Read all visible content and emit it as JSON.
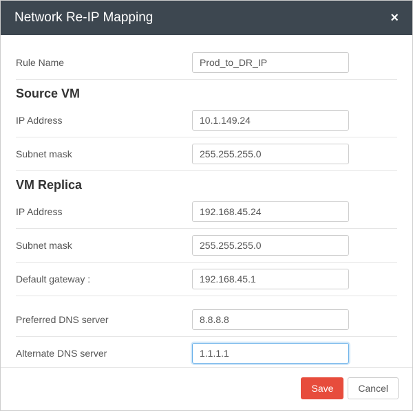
{
  "header": {
    "title": "Network Re-IP Mapping",
    "close_label": "×"
  },
  "rule_name": {
    "label": "Rule Name",
    "value": "Prod_to_DR_IP"
  },
  "source_vm": {
    "heading": "Source VM",
    "ip_address": {
      "label": "IP Address",
      "value": "10.1.149.24"
    },
    "subnet_mask": {
      "label": "Subnet mask",
      "value": "255.255.255.0"
    }
  },
  "vm_replica": {
    "heading": "VM Replica",
    "ip_address": {
      "label": "IP Address",
      "value": "192.168.45.24"
    },
    "subnet_mask": {
      "label": "Subnet mask",
      "value": "255.255.255.0"
    },
    "default_gateway": {
      "label": "Default gateway :",
      "value": "192.168.45.1"
    },
    "preferred_dns": {
      "label": "Preferred DNS server",
      "value": "8.8.8.8"
    },
    "alternate_dns": {
      "label": "Alternate DNS server",
      "value": "1.1.1.1"
    }
  },
  "footer": {
    "save_label": "Save",
    "cancel_label": "Cancel"
  }
}
